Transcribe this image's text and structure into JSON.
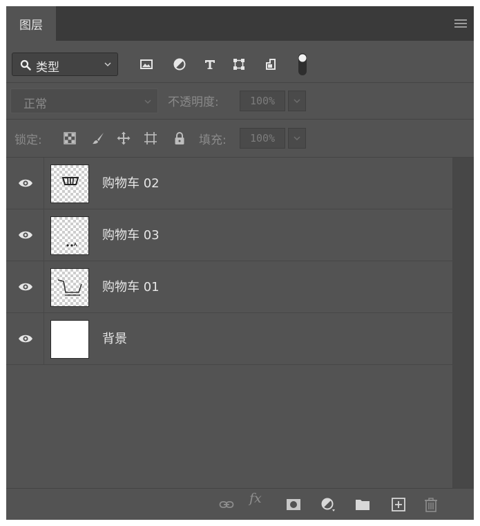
{
  "panel": {
    "tab_label": "图层"
  },
  "filter": {
    "kind_label": "类型",
    "icons": [
      "image-filter-icon",
      "adjustment-filter-icon",
      "type-filter-icon",
      "shape-filter-icon",
      "smart-object-filter-icon",
      "filter-toggle-icon"
    ]
  },
  "blend": {
    "mode": "正常",
    "opacity_label": "不透明度:",
    "opacity_value": "100%"
  },
  "lock": {
    "label": "锁定:",
    "fill_label": "填充:",
    "fill_value": "100%"
  },
  "layers": [
    {
      "name": "购物车 02",
      "thumb": "transparent-cart-basket",
      "visible": true
    },
    {
      "name": "购物车 03",
      "thumb": "transparent-cart-wheels",
      "visible": true
    },
    {
      "name": "购物车 01",
      "thumb": "transparent-cart-body",
      "visible": true
    },
    {
      "name": "背景",
      "thumb": "white",
      "visible": true
    }
  ],
  "bottom_icons": [
    "link-layers-icon",
    "fx-icon",
    "mask-icon",
    "adjustment-layer-icon",
    "group-folder-icon",
    "new-layer-icon",
    "delete-icon"
  ],
  "fx_label": "fx"
}
